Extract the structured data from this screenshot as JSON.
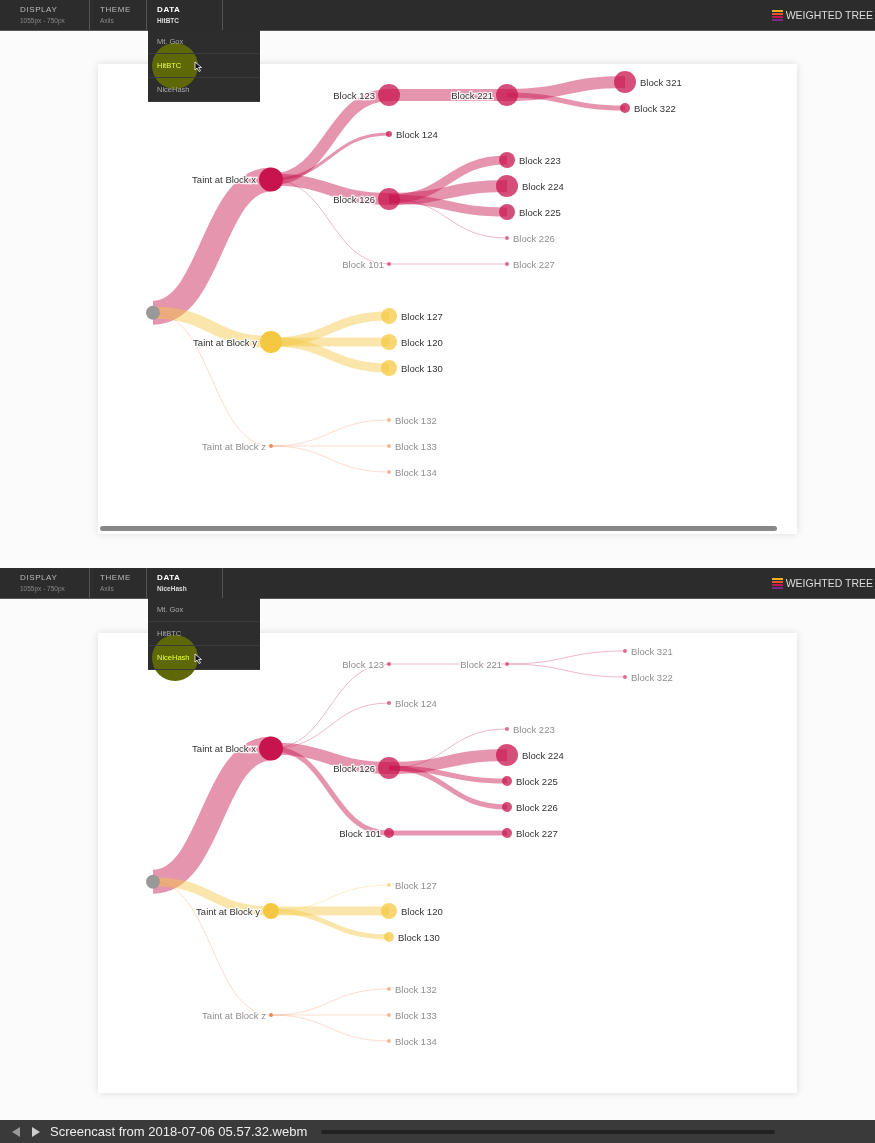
{
  "frames": [
    {
      "menu": [
        {
          "title": "DISPLAY",
          "value": "1055px - 750px",
          "open": false
        },
        {
          "title": "THEME",
          "value": "Axiis",
          "open": false
        },
        {
          "title": "DATA",
          "value": "HitBTC",
          "open": true
        }
      ],
      "dropdown": [
        {
          "label": "Mt. Gox",
          "selected": false
        },
        {
          "label": "HitBTC",
          "selected": true
        },
        {
          "label": "NiceHash",
          "selected": false
        }
      ],
      "brand": "WEIGHTED TREE",
      "tree": {
        "children": [
          {
            "label": "Taint at Block x",
            "color": "#c8144e",
            "kind": "huge",
            "children": [
              {
                "label": "Block 123",
                "kind": "big",
                "children": [
                  {
                    "label": "Block 221",
                    "kind": "big",
                    "children": [
                      {
                        "label": "Block 321",
                        "kind": "big"
                      },
                      {
                        "label": "Block 322",
                        "kind": "small"
                      }
                    ]
                  }
                ]
              },
              {
                "label": "Block 124",
                "kind": "thin"
              },
              {
                "label": "Block 126",
                "kind": "big",
                "children": [
                  {
                    "label": "Block 223",
                    "kind": "mid"
                  },
                  {
                    "label": "Block 224",
                    "kind": "big"
                  },
                  {
                    "label": "Block 225",
                    "kind": "mid"
                  },
                  {
                    "label": "Block 226",
                    "kind": "trace"
                  }
                ]
              },
              {
                "label": "Block 101",
                "kind": "trace",
                "children": [
                  {
                    "label": "Block 227",
                    "kind": "trace"
                  }
                ]
              }
            ]
          },
          {
            "label": "Taint at Block y",
            "color": "#f5c842",
            "kind": "big",
            "children": [
              {
                "label": "Block 127",
                "kind": "mid"
              },
              {
                "label": "Block 120",
                "kind": "mid"
              },
              {
                "label": "Block 130",
                "kind": "mid"
              }
            ]
          },
          {
            "label": "Taint at Block z",
            "color": "#f08a5a",
            "kind": "trace",
            "children": [
              {
                "label": "Block 132",
                "kind": "trace"
              },
              {
                "label": "Block 133",
                "kind": "trace"
              },
              {
                "label": "Block 134",
                "kind": "trace"
              }
            ]
          }
        ]
      }
    },
    {
      "menu": [
        {
          "title": "DISPLAY",
          "value": "1055px - 750px",
          "open": false
        },
        {
          "title": "THEME",
          "value": "Axiis",
          "open": false
        },
        {
          "title": "DATA",
          "value": "NiceHash",
          "open": true
        }
      ],
      "dropdown": [
        {
          "label": "Mt. Gox",
          "selected": false
        },
        {
          "label": "HitBTC",
          "selected": false
        },
        {
          "label": "NiceHash",
          "selected": true
        }
      ],
      "brand": "WEIGHTED TREE",
      "tree": {
        "children": [
          {
            "label": "Taint at Block x",
            "color": "#c8144e",
            "kind": "huge",
            "children": [
              {
                "label": "Block 123",
                "kind": "trace",
                "children": [
                  {
                    "label": "Block 221",
                    "kind": "trace",
                    "children": [
                      {
                        "label": "Block 321",
                        "kind": "trace"
                      },
                      {
                        "label": "Block 322",
                        "kind": "trace"
                      }
                    ]
                  }
                ]
              },
              {
                "label": "Block 124",
                "kind": "trace"
              },
              {
                "label": "Block 126",
                "kind": "big",
                "children": [
                  {
                    "label": "Block 223",
                    "kind": "trace"
                  },
                  {
                    "label": "Block 224",
                    "kind": "big"
                  },
                  {
                    "label": "Block 225",
                    "kind": "small"
                  },
                  {
                    "label": "Block 226",
                    "kind": "small"
                  }
                ]
              },
              {
                "label": "Block 101",
                "kind": "small",
                "children": [
                  {
                    "label": "Block 227",
                    "kind": "small"
                  }
                ]
              }
            ]
          },
          {
            "label": "Taint at Block y",
            "color": "#f5c842",
            "kind": "mid",
            "children": [
              {
                "label": "Block 127",
                "kind": "trace"
              },
              {
                "label": "Block 120",
                "kind": "mid"
              },
              {
                "label": "Block 130",
                "kind": "small"
              }
            ]
          },
          {
            "label": "Taint at Block z",
            "color": "#f08a5a",
            "kind": "trace",
            "children": [
              {
                "label": "Block 132",
                "kind": "trace"
              },
              {
                "label": "Block 133",
                "kind": "trace"
              },
              {
                "label": "Block 134",
                "kind": "trace"
              }
            ]
          }
        ]
      }
    }
  ],
  "player": {
    "title": "Screencast from 2018-07-06 05.57.32.webm"
  }
}
